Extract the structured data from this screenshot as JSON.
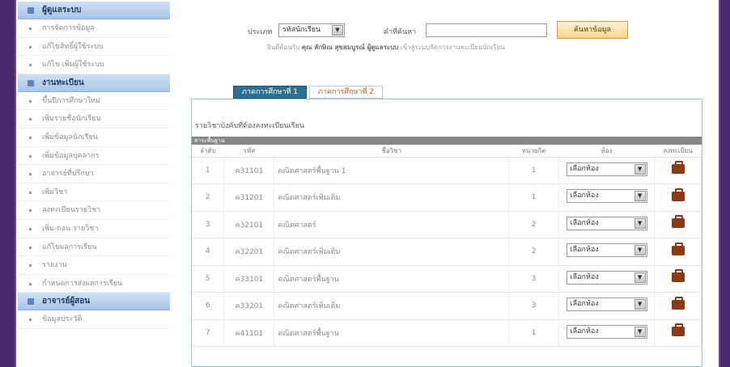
{
  "sidebar": {
    "sections": [
      {
        "header": "ผู้ดูแลระบบ",
        "items": [
          "การจัดการข้อมูล",
          "แก้ไขสิทธิ์ผู้ใช้ระบบ",
          "แก้ไข เพิ่มผู้ใช้ระบบ"
        ]
      },
      {
        "header": "งานทะเบียน",
        "items": [
          "ขึ้นปีการศึกษาใหม่",
          "เพิ่มรายชื่อนักเรียน",
          "เพิ่มข้อมูลนักเรียน",
          "เพิ่มข้อมูลบุคลากร",
          "อาจารย์ที่ปรึกษา",
          "เพิ่มวิชา",
          "ลงทะเบียนรายวิชา",
          "เพิ่ม-ถอน รายวิชา",
          "แก้ไขผลการเรียน",
          "รายงาน",
          "กำหนดการส่งผลการเรียน"
        ]
      },
      {
        "header": "อาจารย์ผู้สอน",
        "items": [
          "ข้อมูลประวัติ"
        ]
      }
    ]
  },
  "search": {
    "type_label": "ประเภท",
    "type_value": "รหัสนักเรียน",
    "keyword_label": "คำที่ค้นหา",
    "keyword_value": "",
    "button_label": "ค้นหาข้อมูล"
  },
  "welcome": {
    "prefix": "ยินดีต้อนรับ",
    "name": "คุณ ลักษิณ สุขสมบูรณ์ ผู้ดูแลระบบ",
    "suffix": "เข้าสู่ระบบจัดการงานทะเบียนนักเรียน"
  },
  "tabs": [
    {
      "label": "ภาคการศึกษาที่ 1",
      "active": true
    },
    {
      "label": "ภาคการศึกษาที่ 2",
      "active": false
    }
  ],
  "panel": {
    "title": "รายวิชาบังคับที่ต้องลงทะเบียนเรียน",
    "section": "สาระพื้นฐาน",
    "columns": [
      "ลำดับ",
      "รหัส",
      "ชื่อวิชา",
      "หน่วยกิต",
      "ห้อง",
      "ลงทะเบียน"
    ],
    "rows": [
      {
        "no": "1",
        "code": "ค31101",
        "name": "คณิตศาสตร์พื้นฐาน 1",
        "credit": "1",
        "room": "เลือกห้อง"
      },
      {
        "no": "2",
        "code": "ค31201",
        "name": "คณิตศาสตร์เพิ่มเติม",
        "credit": "1",
        "room": "เลือกห้อง"
      },
      {
        "no": "3",
        "code": "ค32101",
        "name": "คณิตศาสตร์",
        "credit": "2",
        "room": "เลือกห้อง"
      },
      {
        "no": "4",
        "code": "ค32201",
        "name": "คณิตศาสตร์เพิ่มเติม",
        "credit": "2",
        "room": "เลือกห้อง"
      },
      {
        "no": "5",
        "code": "ค33101",
        "name": "คณิตศาสตร์พื้นฐาน",
        "credit": "3",
        "room": "เลือกห้อง"
      },
      {
        "no": "6",
        "code": "ค33201",
        "name": "คณิตศาสตร์เพิ่มเติม",
        "credit": "3",
        "room": "เลือกห้อง"
      },
      {
        "no": "7",
        "code": "ค41101",
        "name": "คณิตศาสตร์พื้นฐาน",
        "credit": "1",
        "room": "เลือกห้อง"
      }
    ]
  },
  "icons": {
    "dropdown": "chevron-down-icon",
    "register": "briefcase-icon"
  }
}
